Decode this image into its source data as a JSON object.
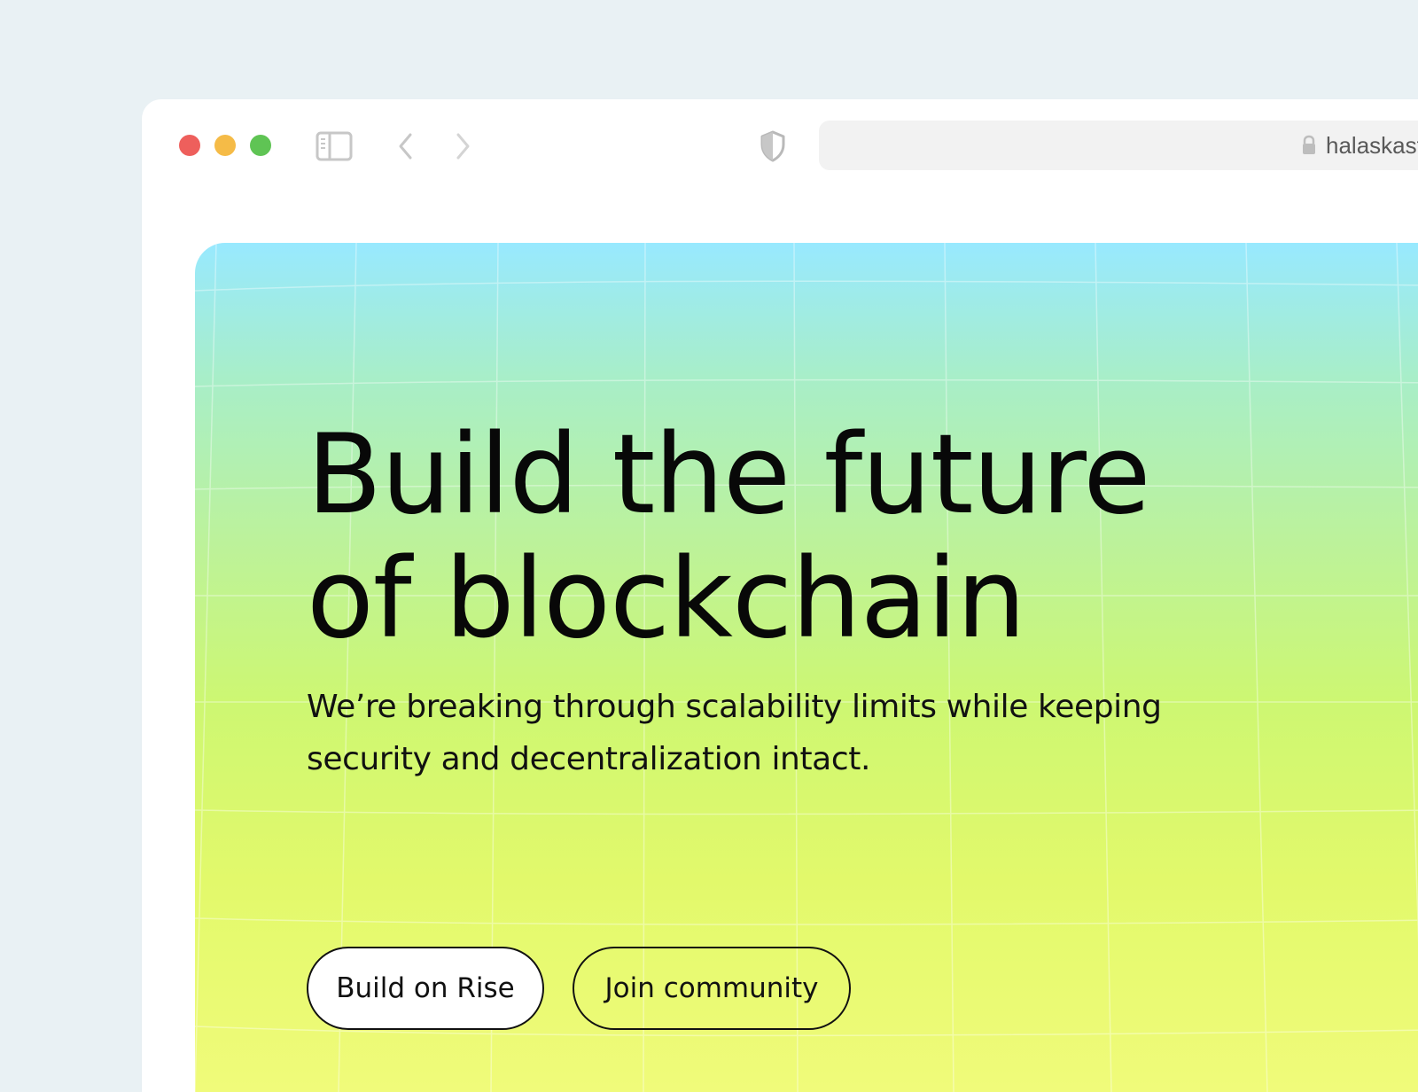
{
  "browser": {
    "url": "halaskastudio.com",
    "traffic_lights": {
      "close_color": "#ee5f5c",
      "minimize_color": "#f5bb47",
      "zoom_color": "#5fc454"
    },
    "icons": [
      "sidebar-toggle-icon",
      "back-arrow-icon",
      "forward-arrow-icon",
      "privacy-shield-icon",
      "lock-icon"
    ]
  },
  "hero": {
    "title_line_1": "Build the future",
    "title_line_2": "of blockchain",
    "subtitle_line_1": "We’re breaking through scalability limits while keeping",
    "subtitle_line_2": "security and decentralization intact.",
    "primary_button_label": "Build on Rise",
    "secondary_button_label": "Join community",
    "gradient_colors": [
      "#98e9ff",
      "#bcf29b",
      "#cdf772",
      "#f0fb7a"
    ]
  }
}
